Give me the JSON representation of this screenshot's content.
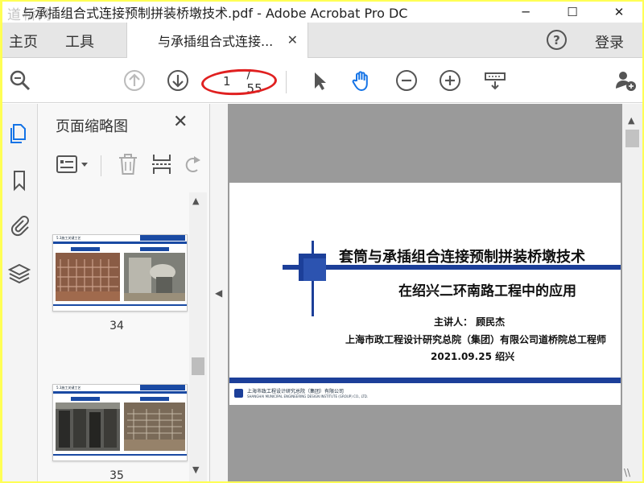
{
  "window": {
    "title": "与承插组合式连接预制拼装桥墩技术.pdf - Adobe Acrobat Pro DC",
    "watermark": "道桥网",
    "minimize": "─",
    "maximize": "☐",
    "close": "✕"
  },
  "menu": {
    "home": "主页",
    "tools": "工具",
    "doc_tab": "与承插组合式连接...",
    "tab_close": "✕",
    "help": "?",
    "login": "登录"
  },
  "toolbar": {
    "current_page": "1",
    "page_sep": "/ 55",
    "annotation_color": "#e02020"
  },
  "thumbnail_panel": {
    "title": "页面缩略图",
    "close": "✕",
    "thumbs": [
      {
        "page_label": "34",
        "heading": "5.3施工关键工艺"
      },
      {
        "page_label": "35",
        "heading": "5.3施工关键工艺"
      }
    ]
  },
  "document": {
    "title_line1": "套筒与承插组合连接预制拼装桥墩技术",
    "title_line2": "在绍兴二环南路工程中的应用",
    "speaker": "主讲人：  顾民杰",
    "organization": "上海市政工程设计研究总院（集团）有限公司道桥院总工程师",
    "date_place": "2021.09.25  绍兴",
    "footer_cn": "上海市政工程设计研究总院（集团）有限公司",
    "footer_en": "SHANGHAI MUNICIPAL ENGINEERING DESIGN INSTITUTE (GROUP) CO., LTD.",
    "accent_color": "#1c3f99"
  },
  "corner_mark": "\\\\"
}
